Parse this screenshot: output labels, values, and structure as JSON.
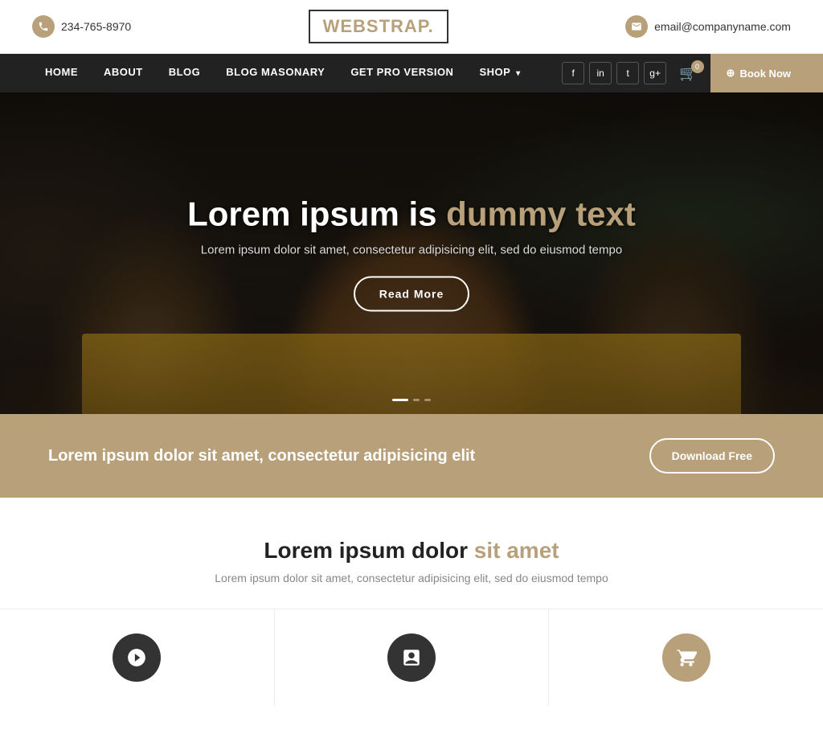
{
  "topbar": {
    "phone": "234-765-8970",
    "email": "email@companyname.com"
  },
  "logo": {
    "text_web": "WEB",
    "text_strap": "STRAP."
  },
  "nav": {
    "links": [
      {
        "label": "HOME",
        "id": "home"
      },
      {
        "label": "ABOUT",
        "id": "about"
      },
      {
        "label": "BLOG",
        "id": "blog"
      },
      {
        "label": "BLOG MASONARY",
        "id": "blog-masonary"
      },
      {
        "label": "GET PRO VERSION",
        "id": "get-pro"
      },
      {
        "label": "SHOP",
        "id": "shop",
        "dropdown": true
      }
    ],
    "social": [
      {
        "icon": "f",
        "name": "facebook"
      },
      {
        "icon": "in",
        "name": "linkedin"
      },
      {
        "icon": "t",
        "name": "twitter"
      },
      {
        "icon": "g+",
        "name": "googleplus"
      }
    ],
    "cart_count": "0",
    "book_now": "Book Now"
  },
  "hero": {
    "title_plain": "Lorem ipsum is ",
    "title_highlight": "dummy text",
    "subtitle": "Lorem ipsum dolor sit amet, consectetur adipisicing elit, sed do eiusmod tempo",
    "cta": "Read More",
    "dots": [
      1,
      2,
      3
    ]
  },
  "download_banner": {
    "text": "Lorem ipsum dolor sit amet, consectetur adipisicing elit",
    "button": "Download Free"
  },
  "section": {
    "title_plain": "Lorem ipsum dolor ",
    "title_highlight": "sit amet",
    "subtitle": "Lorem ipsum dolor sit amet, consectetur adipisicing elit, sed do eiusmod tempo"
  },
  "features": [
    {
      "icon": "⬡",
      "type": "dark"
    },
    {
      "icon": "▦",
      "type": "dark"
    },
    {
      "icon": "🛒",
      "type": "gold"
    }
  ]
}
